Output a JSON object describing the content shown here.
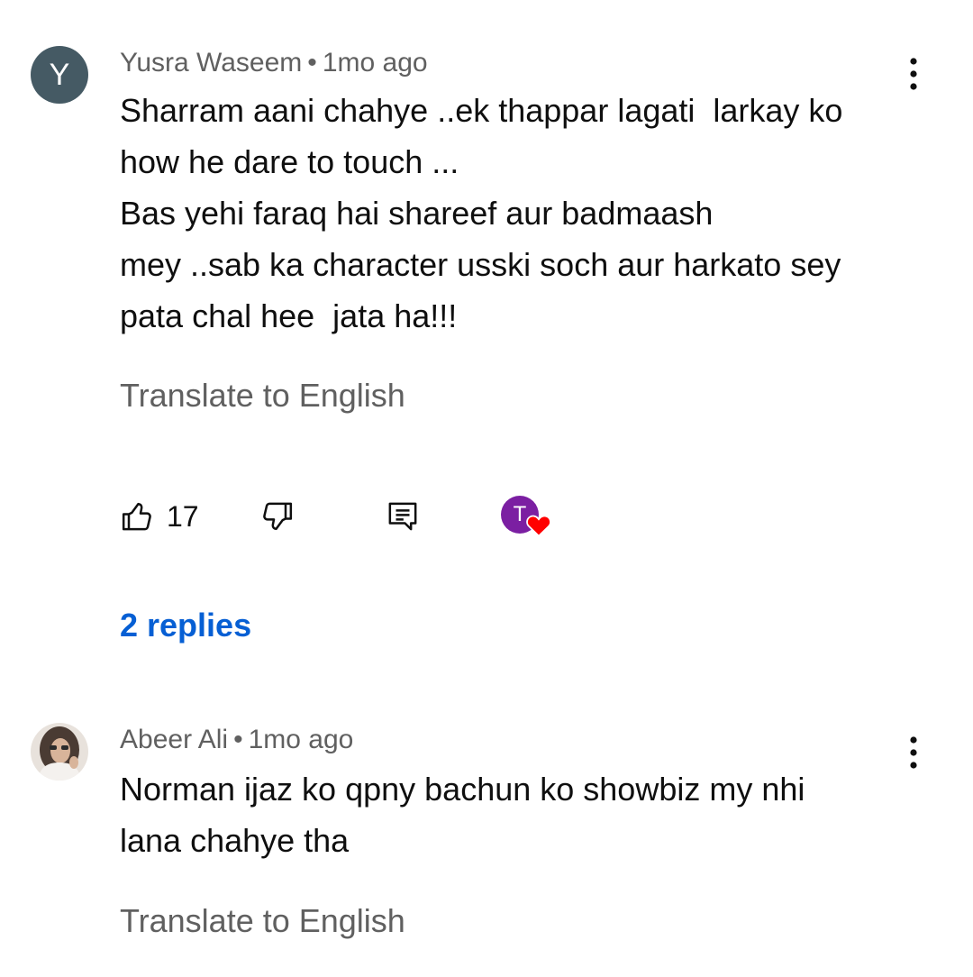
{
  "comments": [
    {
      "author": "Yusra Waseem",
      "separator": "•",
      "time": "1mo ago",
      "avatar_letter": "Y",
      "avatar_color": "#455a64",
      "lines": [
        "Sharram aani chahye ..ek thappar lagati  larkay ko",
        "how he dare to touch ...",
        "Bas yehi faraq hai shareef aur badmaash",
        "mey ..sab ka character usski soch aur harkato sey",
        "pata chal hee  jata ha!!!"
      ],
      "translate_label": "Translate to English",
      "like_count": "17",
      "creator_heart_letter": "T",
      "creator_avatar_color": "#7b1fa2",
      "heart_color": "#ff0000",
      "replies_label": "2 replies",
      "replies_color": "#065fd4"
    },
    {
      "author": "Abeer Ali",
      "separator": "•",
      "time": "1mo ago",
      "lines": [
        "Norman ijaz ko qpny bachun ko showbiz my nhi",
        "lana chahye tha"
      ],
      "translate_label": "Translate to English"
    }
  ],
  "icons": {
    "like": "thumbs-up-icon",
    "dislike": "thumbs-down-icon",
    "reply": "reply-comment-icon",
    "menu": "more-vertical-icon"
  }
}
